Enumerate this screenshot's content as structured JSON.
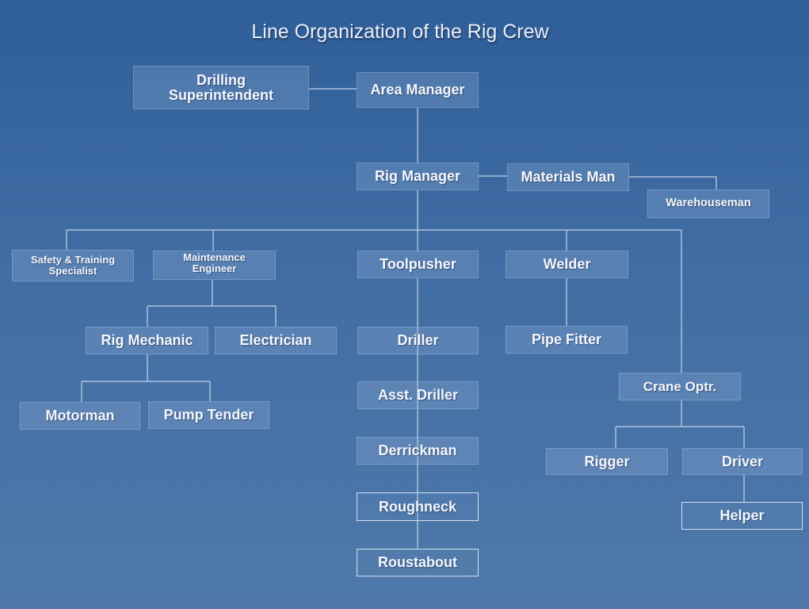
{
  "title": "Line Organization of the Rig Crew",
  "colors": {
    "background_top": "#2f5e98",
    "background_bottom": "#5079aa",
    "box_text": "#f4f7fb",
    "connector": "#c3d3e8"
  },
  "nodes": {
    "drilling_superintendent": "Drilling\nSuperintendent",
    "area_manager": "Area Manager",
    "rig_manager": "Rig Manager",
    "materials_man": "Materials Man",
    "warehouseman": "Warehouseman",
    "safety_training_specialist": "Safety & Training\nSpecialist",
    "maintenance_engineer": "Maintenance\nEngineer",
    "toolpusher": "Toolpusher",
    "welder": "Welder",
    "rig_mechanic": "Rig Mechanic",
    "electrician": "Electrician",
    "driller": "Driller",
    "pipe_fitter": "Pipe Fitter",
    "crane_optr": "Crane Optr.",
    "asst_driller": "Asst. Driller",
    "motorman": "Motorman",
    "pump_tender": "Pump Tender",
    "derrickman": "Derrickman",
    "rigger": "Rigger",
    "driver": "Driver",
    "roughneck": "Roughneck",
    "helper": "Helper",
    "roustabout": "Roustabout"
  },
  "edges": [
    [
      "drilling_superintendent",
      "area_manager"
    ],
    [
      "area_manager",
      "rig_manager"
    ],
    [
      "rig_manager",
      "materials_man"
    ],
    [
      "materials_man",
      "warehouseman"
    ],
    [
      "rig_manager",
      "safety_training_specialist"
    ],
    [
      "rig_manager",
      "maintenance_engineer"
    ],
    [
      "rig_manager",
      "toolpusher"
    ],
    [
      "rig_manager",
      "welder"
    ],
    [
      "rig_manager",
      "crane_optr"
    ],
    [
      "maintenance_engineer",
      "rig_mechanic"
    ],
    [
      "maintenance_engineer",
      "electrician"
    ],
    [
      "rig_mechanic",
      "motorman"
    ],
    [
      "rig_mechanic",
      "pump_tender"
    ],
    [
      "toolpusher",
      "driller"
    ],
    [
      "driller",
      "asst_driller"
    ],
    [
      "asst_driller",
      "derrickman"
    ],
    [
      "derrickman",
      "roughneck"
    ],
    [
      "roughneck",
      "roustabout"
    ],
    [
      "welder",
      "pipe_fitter"
    ],
    [
      "crane_optr",
      "rigger"
    ],
    [
      "crane_optr",
      "driver"
    ],
    [
      "driver",
      "helper"
    ]
  ]
}
